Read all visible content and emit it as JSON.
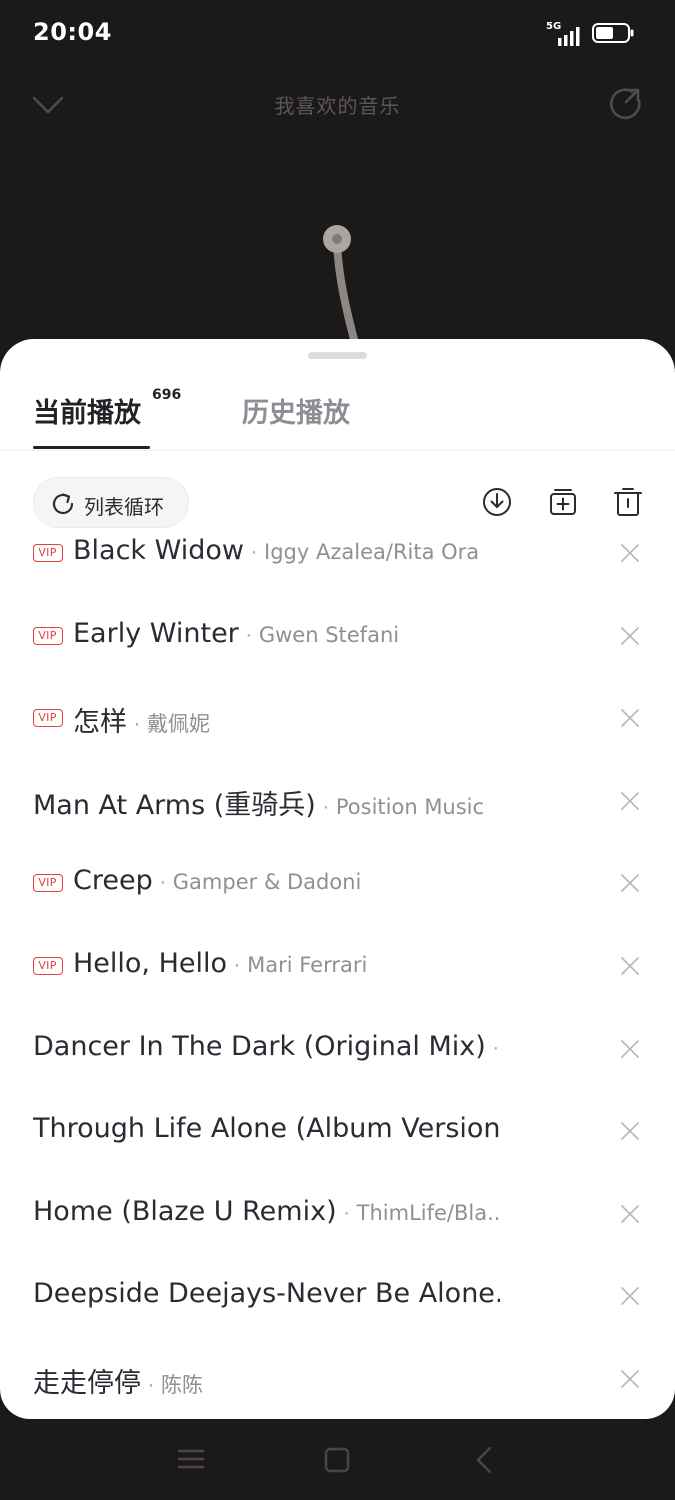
{
  "status_bar": {
    "time": "20:04",
    "network": "5G"
  },
  "header": {
    "playlist_title": "我喜欢的音乐"
  },
  "sheet": {
    "tabs": {
      "current_label": "当前播放",
      "current_count": "696",
      "history_label": "历史播放"
    },
    "toolbar": {
      "loop_mode_label": "列表循环"
    },
    "vip_label": "VIP",
    "songs": [
      {
        "title": "Black Widow",
        "artist": "Iggy Azalea/Rita Ora",
        "vip": true,
        "sep": "·"
      },
      {
        "title": "Early Winter",
        "artist": "Gwen Stefani",
        "vip": true,
        "sep": "·"
      },
      {
        "title": "怎样",
        "artist": "戴佩妮",
        "vip": true,
        "sep": "·"
      },
      {
        "title": "Man At Arms (重骑兵)",
        "artist": "Position Music",
        "vip": false,
        "sep": "·"
      },
      {
        "title": "Creep",
        "artist": "Gamper & Dadoni",
        "vip": true,
        "sep": "·"
      },
      {
        "title": "Hello, Hello",
        "artist": "Mari Ferrari",
        "vip": true,
        "sep": "·"
      },
      {
        "title": "Dancer In The Dark (Original Mix)",
        "artist": "...",
        "vip": false,
        "sep": "·"
      },
      {
        "title": "Through Life Alone (Album Version...",
        "artist": "",
        "vip": false,
        "sep": ""
      },
      {
        "title": "Home (Blaze U Remix)",
        "artist": "ThimLife/Bla...",
        "vip": false,
        "sep": "·"
      },
      {
        "title": "Deepside Deejays-Never Be Alone...",
        "artist": "",
        "vip": false,
        "sep": ""
      },
      {
        "title": "走走停停",
        "artist": "陈陈",
        "vip": false,
        "sep": "·"
      }
    ]
  },
  "colors": {
    "vip_red": "#e0413a",
    "title_text": "#2a2c33",
    "artist_text": "#8e9096",
    "dark_bg": "#1c1a19"
  },
  "icons": [
    "chevron-down-icon",
    "share-icon",
    "loop-icon",
    "download-icon",
    "add-to-playlist-icon",
    "trash-icon",
    "close-icon",
    "nav-menu-icon",
    "nav-home-icon",
    "nav-back-icon"
  ]
}
